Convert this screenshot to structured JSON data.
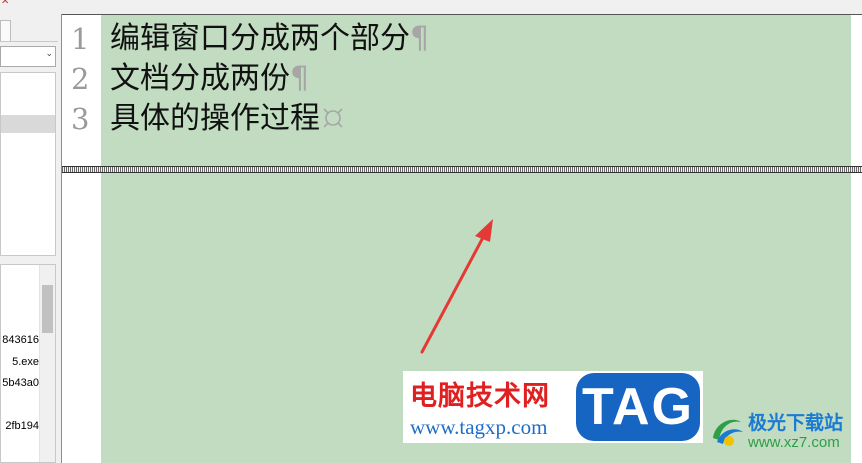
{
  "editor": {
    "lines": [
      {
        "number": "1",
        "text": "编辑窗口分成两个部分",
        "end_mark": "¶"
      },
      {
        "number": "2",
        "text": "文档分成两份",
        "end_mark": "¶"
      },
      {
        "number": "3",
        "text": "具体的操作过程",
        "end_mark": ""
      }
    ],
    "content_color": "#c1dcc1"
  },
  "left_panel": {
    "file_list": [
      "843616",
      "5.exe",
      "5b43a0",
      "2fb194"
    ]
  },
  "annotation": {
    "arrow_color": "#e53935"
  },
  "watermark": {
    "site_name": "电脑技术网",
    "badge": "TAG",
    "url": "www.tagxp.com"
  },
  "logo": {
    "name": "极光下载站",
    "url": "www.xz7.com"
  },
  "icons": [
    "close-icon",
    "chevron-down-icon",
    "eof-marker-icon",
    "aurora-logo-icon"
  ]
}
